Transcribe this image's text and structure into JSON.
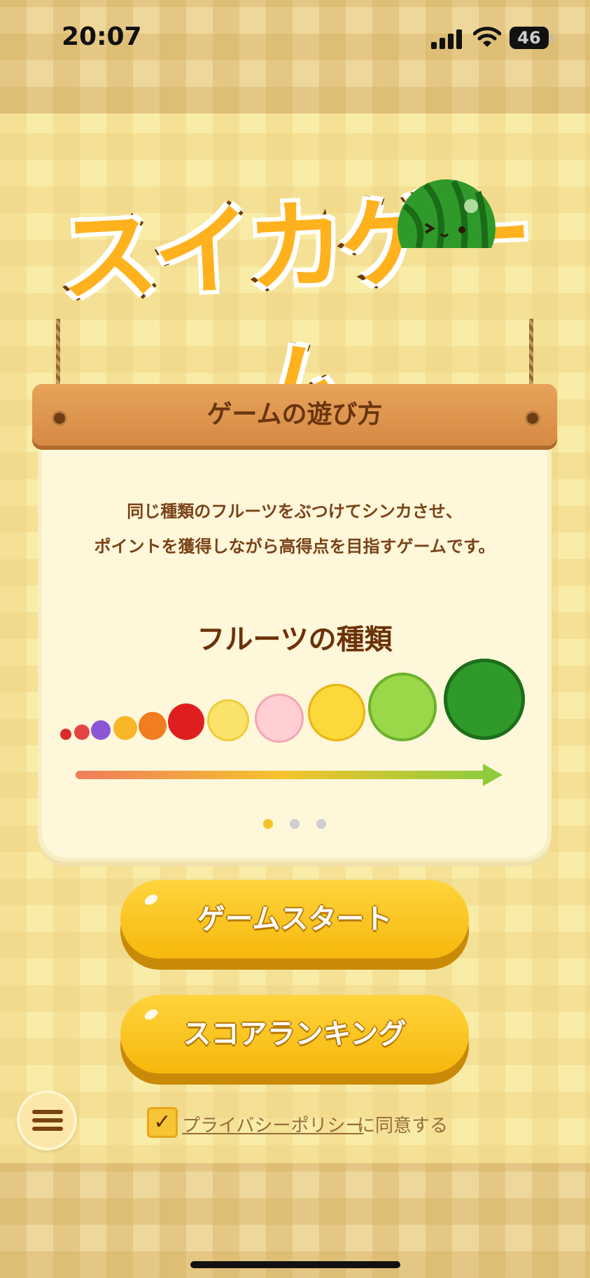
{
  "status_bar": {
    "time": "20:07",
    "battery": "46"
  },
  "logo": {
    "title": "スイカゲーム"
  },
  "how_to_play": {
    "header": "ゲームの遊び方",
    "description_line1": "同じ種類のフルーツをぶつけてシンカさせ、",
    "description_line2": "ポイントを獲得しながら高得点を目指すゲームです。",
    "fruits_title": "フルーツの種類",
    "fruits": [
      "cherry",
      "strawberry",
      "grape",
      "dekopon",
      "persimmon",
      "apple",
      "pear",
      "peach",
      "pineapple",
      "melon",
      "watermelon"
    ],
    "page_indicator": {
      "pages": 3,
      "current": 1
    }
  },
  "buttons": {
    "start": "ゲームスタート",
    "ranking": "スコアランキング"
  },
  "consent": {
    "checked": true,
    "checkmark": "✓",
    "link": "プライバシーポリシー",
    "tail": "に同意する"
  },
  "colors": {
    "accent": "#f6c226",
    "brown": "#6b3208",
    "board": "#d68a45",
    "watermelon": "#2f9a2a"
  }
}
